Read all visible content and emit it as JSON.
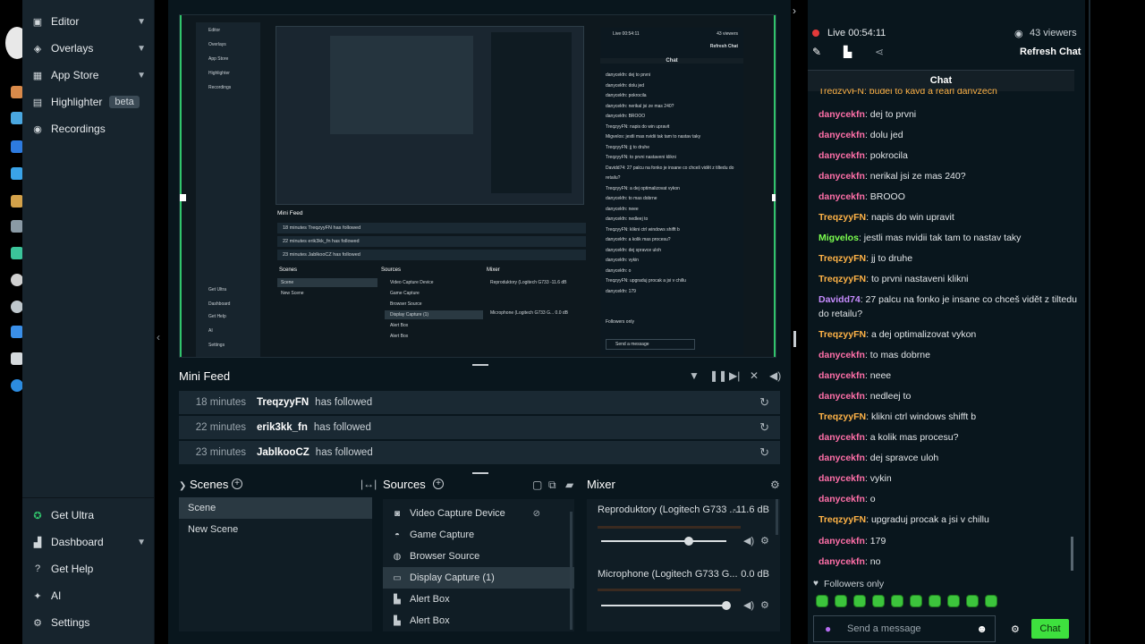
{
  "nav": {
    "items": [
      {
        "label": "Editor",
        "icon": "editor-icon",
        "has_chevron": true
      },
      {
        "label": "Overlays",
        "icon": "overlays-icon",
        "has_chevron": true
      },
      {
        "label": "App Store",
        "icon": "app-store-icon",
        "has_chevron": true
      },
      {
        "label": "Highlighter",
        "icon": "highlighter-icon",
        "badge": "beta"
      },
      {
        "label": "Recordings",
        "icon": "recordings-icon"
      }
    ],
    "bottom_items": [
      {
        "label": "Get Ultra",
        "icon": "ultra-icon"
      },
      {
        "label": "Dashboard",
        "icon": "dashboard-icon",
        "has_chevron": true
      },
      {
        "label": "Get Help",
        "icon": "help-icon"
      },
      {
        "label": "AI",
        "icon": "ai-icon"
      },
      {
        "label": "Settings",
        "icon": "settings-icon"
      }
    ]
  },
  "mini_feed": {
    "title": "Mini Feed",
    "rows": [
      {
        "time": "18 minutes",
        "user": "TreqzyyFN",
        "action": "has followed"
      },
      {
        "time": "22 minutes",
        "user": "erik3kk_fn",
        "action": "has followed"
      },
      {
        "time": "23 minutes",
        "user": "JablkooCZ",
        "action": "has followed"
      }
    ]
  },
  "scenes": {
    "title": "Scenes",
    "items": [
      {
        "label": "Scene",
        "selected": true
      },
      {
        "label": "New Scene",
        "selected": false
      }
    ]
  },
  "sources": {
    "title": "Sources",
    "items": [
      {
        "label": "Video Capture Device",
        "icon": "camera-icon"
      },
      {
        "label": "Game Capture",
        "icon": "gamepad-icon"
      },
      {
        "label": "Browser Source",
        "icon": "globe-icon"
      },
      {
        "label": "Display Capture (1)",
        "icon": "monitor-icon",
        "selected": true
      },
      {
        "label": "Alert Box",
        "icon": "alert-box-icon"
      },
      {
        "label": "Alert Box",
        "icon": "alert-box-icon"
      }
    ]
  },
  "mixer": {
    "title": "Mixer",
    "channels": [
      {
        "name": "Reproduktory (Logitech G733 ...",
        "db": "-11.6 dB",
        "level": 0.7
      },
      {
        "name": "Microphone (Logitech G733 G...",
        "db": "0.0 dB",
        "level": 1.0
      }
    ]
  },
  "chat_header": {
    "live": "Live 00:54:11",
    "viewers": "43 viewers",
    "refresh": "Refresh Chat",
    "title": "Chat"
  },
  "chat": {
    "partial_top": "TreqzyyFN: budej to kayd a rearl danyzecn",
    "messages": [
      {
        "user": "danycekfn",
        "text": "dej to prvni",
        "color": "#ff6fa8"
      },
      {
        "user": "danycekfn",
        "text": "dolu jed",
        "color": "#ff6fa8"
      },
      {
        "user": "danycekfn",
        "text": "pokrocila",
        "color": "#ff6fa8"
      },
      {
        "user": "danycekfn",
        "text": "nerikal jsi ze mas 240?",
        "color": "#ff6fa8"
      },
      {
        "user": "danycekfn",
        "text": "BROOO",
        "color": "#ff6fa8"
      },
      {
        "user": "TreqzyyFN",
        "text": "napis do win upravit",
        "color": "#ffb347"
      },
      {
        "user": "Migvelos",
        "text": "jestli mas nvidii tak tam to nastav taky",
        "color": "#7cff4f"
      },
      {
        "user": "TreqzyyFN",
        "text": "jj to druhe",
        "color": "#ffb347"
      },
      {
        "user": "TreqzyyFN",
        "text": "to prvni nastaveni klikni",
        "color": "#ffb347"
      },
      {
        "user": "Davidd74",
        "text": "27 palcu na fonko je insane co chceš vidět z tiltedu do retailu?",
        "color": "#c78cff"
      },
      {
        "user": "TreqzyyFN",
        "text": "a dej optimalizovat vykon",
        "color": "#ffb347"
      },
      {
        "user": "danycekfn",
        "text": "to mas dobrne",
        "color": "#ff6fa8"
      },
      {
        "user": "danycekfn",
        "text": "neee",
        "color": "#ff6fa8"
      },
      {
        "user": "danycekfn",
        "text": "nedleej to",
        "color": "#ff6fa8"
      },
      {
        "user": "TreqzyyFN",
        "text": "klikni ctrl windows shifft b",
        "color": "#ffb347"
      },
      {
        "user": "danycekfn",
        "text": "a kolik mas procesu?",
        "color": "#ff6fa8"
      },
      {
        "user": "danycekfn",
        "text": "dej spravce uloh",
        "color": "#ff6fa8"
      },
      {
        "user": "danycekfn",
        "text": "vykin",
        "color": "#ff6fa8"
      },
      {
        "user": "danycekfn",
        "text": "o",
        "color": "#ff6fa8"
      },
      {
        "user": "TreqzyyFN",
        "text": "upgraduj procak a jsi v chillu",
        "color": "#ffb347"
      },
      {
        "user": "danycekfn",
        "text": "179",
        "color": "#ff6fa8"
      },
      {
        "user": "danycekfn",
        "text": "no",
        "color": "#ff6fa8"
      }
    ],
    "followers_only": "Followers only",
    "input_placeholder": "Send a message",
    "send_label": "Chat"
  },
  "preview_mini": {
    "feed_title": "Mini Feed",
    "scenes": "Scenes",
    "sources": "Sources",
    "mixer": "Mixer",
    "chat": "Chat",
    "live": "Live 00:54:11",
    "viewers": "43 viewers",
    "refresh": "Refresh Chat",
    "send": "Send a message",
    "followers": "Followers only",
    "nav": [
      "Editor",
      "Overlays",
      "App Store",
      "Highlighter",
      "Recordings"
    ],
    "nav_bottom": [
      "Get Ultra",
      "Dashboard",
      "Get Help",
      "AI",
      "Settings"
    ],
    "feed_rows": [
      "18 minutes  TreqzyyFN  has followed",
      "22 minutes  erik3kk_fn  has followed",
      "23 minutes  JablkooCZ  has followed"
    ],
    "scene_rows": [
      "Scene",
      "New Scene"
    ],
    "source_rows": [
      "Video Capture Device",
      "Game Capture",
      "Browser Source",
      "Display Capture (1)",
      "Alert Box",
      "Alert Box"
    ],
    "mixer_rows": [
      "Reproduktory (Logitech G733 -11.6 dB",
      "Microphone (Logitech G733 G... 0.0 dB"
    ],
    "chat_lines": [
      "danycekfn: dej to prvni",
      "danycekfn: dolu jed",
      "danycekfn: pokrocila",
      "danycekfn: nerikal jsi ze mas 240?",
      "danycekfn: BROOO",
      "TreqzyyFN: napis do win upravit",
      "Migvelos: jestli mas nvidii tak tam to nastav taky",
      "TreqzyyFN: jj to druhe",
      "TreqzyyFN: to prvni nastaveni klikni",
      "Davidd74: 27 palcu na fonko je insane co chceš vidět z tiltedu do retailu?",
      "TreqzyyFN: a dej optimalizovat vykon",
      "danycekfn: to mas dobrne",
      "danycekfn: neee",
      "danycekfn: nedleej to",
      "TreqzyyFN: klikni ctrl windows shifft b",
      "danycekfn: a kolik mas procesu?",
      "danycekfn: dej spravce uloh",
      "danycekfn: vykin",
      "danycekfn: o",
      "TreqzyyFN: upgraduj procak a jsi v chillu",
      "danycekfn: 179"
    ]
  },
  "colors": {
    "accent_green": "#31c46c",
    "send_button": "#3ee03e",
    "live_dot": "#e33a3a"
  }
}
